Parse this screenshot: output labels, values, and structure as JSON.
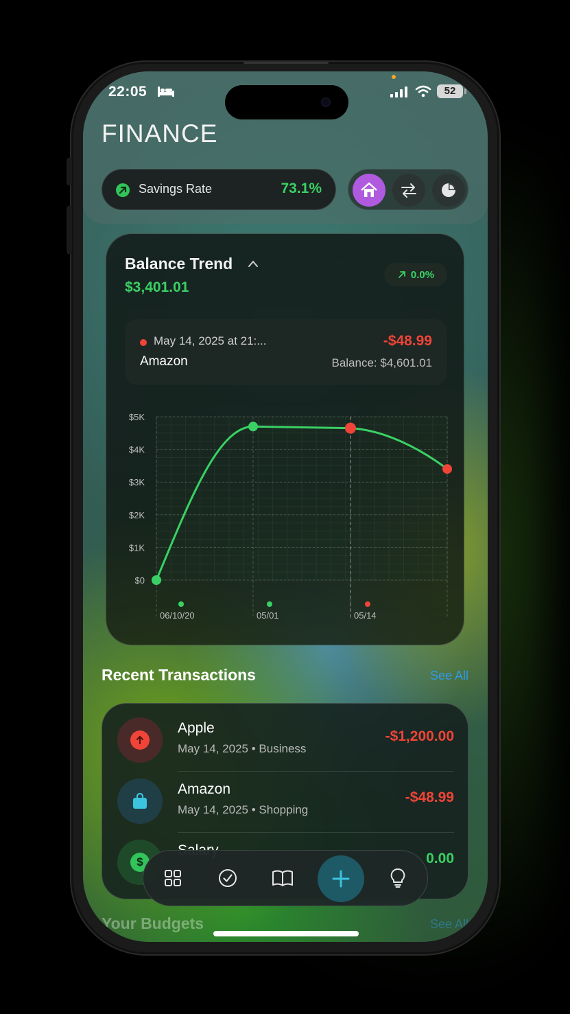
{
  "status_bar": {
    "time": "22:05",
    "battery": "52",
    "icons": [
      "bed-icon",
      "signal-icon",
      "wifi-icon",
      "battery-icon"
    ]
  },
  "header": {
    "title": "FINANCE",
    "savings": {
      "label": "Savings Rate",
      "value": "73.1%"
    },
    "nav": [
      {
        "name": "home-icon",
        "active": true
      },
      {
        "name": "transfer-arrows-icon",
        "active": false
      },
      {
        "name": "pie-chart-icon",
        "active": false
      }
    ]
  },
  "balance_card": {
    "title": "Balance Trend",
    "amount": "$3,401.01",
    "change": "0.0%",
    "tooltip": {
      "date": "May 14, 2025 at 21:...",
      "merchant": "Amazon",
      "amount": "-$48.99",
      "balance": "Balance: $4,601.01"
    }
  },
  "chart_data": {
    "type": "line",
    "title": "",
    "xlabel": "",
    "ylabel": "",
    "y_ticks": [
      "$5K",
      "$4K",
      "$3K",
      "$2K",
      "$1K",
      "$0"
    ],
    "x_ticks": [
      "06/10/20",
      "05/01",
      "05/14"
    ],
    "ylim": [
      0,
      5000
    ],
    "grid": true,
    "points": [
      {
        "x": "06/10/20",
        "y": 0,
        "color": "#3ad164"
      },
      {
        "x": "05/01",
        "y": 4700,
        "color": "#3ad164"
      },
      {
        "x": "05/14",
        "y": 4650,
        "color": "#f04438",
        "selected": true
      },
      {
        "x": "05/14+",
        "y": 3401,
        "color": "#f04438"
      }
    ],
    "marker_dots": [
      {
        "x": "06/10/20",
        "color": "#3ad164"
      },
      {
        "x": "05/01",
        "color": "#3ad164"
      },
      {
        "x": "05/14",
        "color": "#f04438"
      }
    ],
    "line_color": "#3ad164"
  },
  "recent_transactions": {
    "title": "Recent Transactions",
    "see_all": "See All",
    "items": [
      {
        "name": "Apple",
        "date": "May 14, 2025",
        "category": "Business",
        "amount": "-$1,200.00",
        "amount_color": "#f04438",
        "icon": "arrow-up-icon",
        "icon_bg": "#4a2a28",
        "icon_fg": "#f04438"
      },
      {
        "name": "Amazon",
        "date": "May 14, 2025",
        "category": "Shopping",
        "amount": "-$48.99",
        "amount_color": "#f04438",
        "icon": "shopping-bag-icon",
        "icon_bg": "#1f3e46",
        "icon_fg": "#3cc3e0"
      },
      {
        "name": "Salary",
        "date": "",
        "category": "",
        "amount": "0.00",
        "amount_color": "#3ad164",
        "icon": "dollar-icon",
        "icon_bg": "#1e4a2a",
        "icon_fg": "#32c45a"
      }
    ]
  },
  "tab_bar": {
    "items": [
      "grid-icon",
      "checkmark-circle-icon",
      "book-icon",
      "plus-icon",
      "lightbulb-icon"
    ]
  },
  "budgets": {
    "title": "Your Budgets",
    "see_all": "See All"
  }
}
